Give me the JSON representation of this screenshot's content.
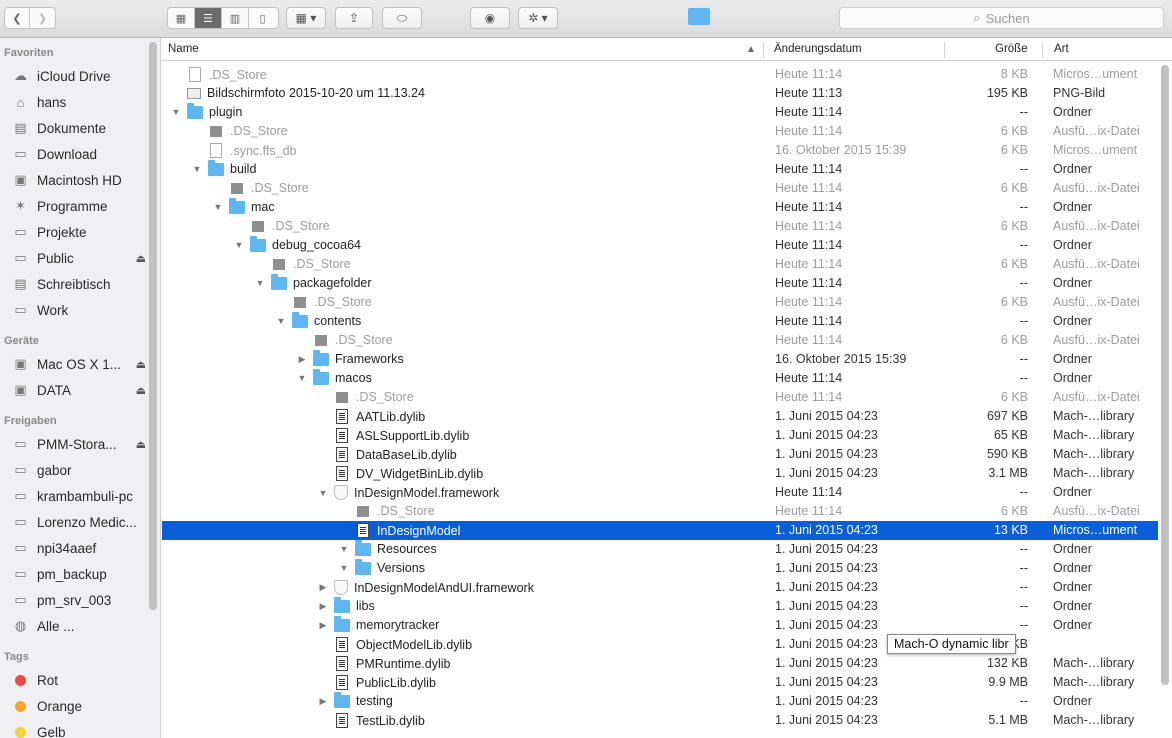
{
  "toolbar": {
    "back_icon": "chevron-left-icon",
    "forward_icon": "chevron-right-icon",
    "search_placeholder": "Suchen"
  },
  "sidebar": {
    "favorites_title": "Favoriten",
    "favorites": [
      {
        "label": "iCloud Drive",
        "icon": "cloud-icon",
        "glyph": "☁"
      },
      {
        "label": "hans",
        "icon": "home-icon",
        "glyph": "⌂"
      },
      {
        "label": "Dokumente",
        "icon": "document-icon",
        "glyph": "▤"
      },
      {
        "label": "Download",
        "icon": "folder-icon",
        "glyph": "▭"
      },
      {
        "label": "Macintosh HD",
        "icon": "hard-drive-icon",
        "glyph": "▣"
      },
      {
        "label": "Programme",
        "icon": "applications-icon",
        "glyph": "✶"
      },
      {
        "label": "Projekte",
        "icon": "folder-icon",
        "glyph": "▭"
      },
      {
        "label": "Public",
        "icon": "folder-icon",
        "glyph": "▭",
        "eject": true
      },
      {
        "label": "Schreibtisch",
        "icon": "desktop-icon",
        "glyph": "▤"
      },
      {
        "label": "Work",
        "icon": "folder-icon",
        "glyph": "▭"
      }
    ],
    "devices_title": "Geräte",
    "devices": [
      {
        "label": "Mac OS X 1...",
        "icon": "hard-drive-icon",
        "glyph": "▣",
        "eject": true
      },
      {
        "label": "DATA",
        "icon": "hard-drive-icon",
        "glyph": "▣",
        "eject": true
      }
    ],
    "shared_title": "Freigaben",
    "shared": [
      {
        "label": "PMM-Stora...",
        "icon": "server-icon",
        "glyph": "▭",
        "eject": true
      },
      {
        "label": "gabor",
        "icon": "computer-icon",
        "glyph": "▭"
      },
      {
        "label": "krambambuli-pc",
        "icon": "computer-icon",
        "glyph": "▭"
      },
      {
        "label": "Lorenzo Medic...",
        "icon": "computer-icon",
        "glyph": "▭"
      },
      {
        "label": "npi34aaef",
        "icon": "computer-icon",
        "glyph": "▭"
      },
      {
        "label": "pm_backup",
        "icon": "computer-icon",
        "glyph": "▭"
      },
      {
        "label": "pm_srv_003",
        "icon": "computer-icon",
        "glyph": "▭"
      },
      {
        "label": "Alle ...",
        "icon": "network-icon",
        "glyph": "◍"
      }
    ],
    "tags_title": "Tags",
    "tags": [
      {
        "label": "Rot",
        "color": "#f04848"
      },
      {
        "label": "Orange",
        "color": "#f5a631"
      },
      {
        "label": "Gelb",
        "color": "#f2d43b"
      }
    ]
  },
  "columns": {
    "name": "Name",
    "date": "Änderungsdatum",
    "size": "Größe",
    "kind": "Art"
  },
  "rows": [
    {
      "name": ".DS_Store",
      "date": "Heute 11:14",
      "size": "8 KB",
      "kind": "Micros…ument",
      "depth": 0,
      "icon": "docl",
      "dim": true
    },
    {
      "name": "Bildschirmfoto 2015-10-20 um 11.13.24",
      "date": "Heute 11:13",
      "size": "195 KB",
      "kind": "PNG-Bild",
      "depth": 0,
      "icon": "img"
    },
    {
      "name": "plugin",
      "date": "Heute 11:14",
      "size": "--",
      "kind": "Ordner",
      "depth": 0,
      "icon": "folder",
      "tri": "down"
    },
    {
      "name": ".DS_Store",
      "date": "Heute 11:14",
      "size": "6 KB",
      "kind": "Ausfü…ix-Datei",
      "depth": 1,
      "icon": "gray",
      "dim": true
    },
    {
      "name": ".sync.ffs_db",
      "date": "16. Oktober 2015 15:39",
      "size": "6 KB",
      "kind": "Micros…ument",
      "depth": 1,
      "icon": "docl",
      "dim": true
    },
    {
      "name": "build",
      "date": "Heute 11:14",
      "size": "--",
      "kind": "Ordner",
      "depth": 1,
      "icon": "folder",
      "tri": "down"
    },
    {
      "name": ".DS_Store",
      "date": "Heute 11:14",
      "size": "6 KB",
      "kind": "Ausfü…ix-Datei",
      "depth": 2,
      "icon": "gray",
      "dim": true
    },
    {
      "name": "mac",
      "date": "Heute 11:14",
      "size": "--",
      "kind": "Ordner",
      "depth": 2,
      "icon": "folder",
      "tri": "down"
    },
    {
      "name": ".DS_Store",
      "date": "Heute 11:14",
      "size": "6 KB",
      "kind": "Ausfü…ix-Datei",
      "depth": 3,
      "icon": "gray",
      "dim": true
    },
    {
      "name": "debug_cocoa64",
      "date": "Heute 11:14",
      "size": "--",
      "kind": "Ordner",
      "depth": 3,
      "icon": "folder",
      "tri": "down"
    },
    {
      "name": ".DS_Store",
      "date": "Heute 11:14",
      "size": "6 KB",
      "kind": "Ausfü…ix-Datei",
      "depth": 4,
      "icon": "gray",
      "dim": true
    },
    {
      "name": "packagefolder",
      "date": "Heute 11:14",
      "size": "--",
      "kind": "Ordner",
      "depth": 4,
      "icon": "folder",
      "tri": "down"
    },
    {
      "name": ".DS_Store",
      "date": "Heute 11:14",
      "size": "6 KB",
      "kind": "Ausfü…ix-Datei",
      "depth": 5,
      "icon": "gray",
      "dim": true
    },
    {
      "name": "contents",
      "date": "Heute 11:14",
      "size": "--",
      "kind": "Ordner",
      "depth": 5,
      "icon": "folder",
      "tri": "down"
    },
    {
      "name": ".DS_Store",
      "date": "Heute 11:14",
      "size": "6 KB",
      "kind": "Ausfü…ix-Datei",
      "depth": 6,
      "icon": "gray",
      "dim": true
    },
    {
      "name": "Frameworks",
      "date": "16. Oktober 2015 15:39",
      "size": "--",
      "kind": "Ordner",
      "depth": 6,
      "icon": "folder",
      "tri": "right"
    },
    {
      "name": "macos",
      "date": "Heute 11:14",
      "size": "--",
      "kind": "Ordner",
      "depth": 6,
      "icon": "folder",
      "tri": "down"
    },
    {
      "name": ".DS_Store",
      "date": "Heute 11:14",
      "size": "6 KB",
      "kind": "Ausfü…ix-Datei",
      "depth": 7,
      "icon": "gray",
      "dim": true
    },
    {
      "name": "AATLib.dylib",
      "date": "1. Juni 2015 04:23",
      "size": "697 KB",
      "kind": "Mach-…library",
      "depth": 7,
      "icon": "doc"
    },
    {
      "name": "ASLSupportLib.dylib",
      "date": "1. Juni 2015 04:23",
      "size": "65 KB",
      "kind": "Mach-…library",
      "depth": 7,
      "icon": "doc"
    },
    {
      "name": "DataBaseLib.dylib",
      "date": "1. Juni 2015 04:23",
      "size": "590 KB",
      "kind": "Mach-…library",
      "depth": 7,
      "icon": "doc"
    },
    {
      "name": "DV_WidgetBinLib.dylib",
      "date": "1. Juni 2015 04:23",
      "size": "3.1 MB",
      "kind": "Mach-…library",
      "depth": 7,
      "icon": "doc"
    },
    {
      "name": "InDesignModel.framework",
      "date": "Heute 11:14",
      "size": "--",
      "kind": "Ordner",
      "depth": 7,
      "icon": "fw",
      "tri": "down"
    },
    {
      "name": ".DS_Store",
      "date": "Heute 11:14",
      "size": "6 KB",
      "kind": "Ausfü…ix-Datei",
      "depth": 8,
      "icon": "gray",
      "dim": true
    },
    {
      "name": "InDesignModel",
      "date": "1. Juni 2015 04:23",
      "size": "13 KB",
      "kind": "Micros…ument",
      "depth": 8,
      "icon": "doc",
      "selected": true
    },
    {
      "name": "Resources",
      "date": "1. Juni 2015 04:23",
      "size": "--",
      "kind": "Ordner",
      "depth": 8,
      "icon": "folder",
      "tri": "down"
    },
    {
      "name": "Versions",
      "date": "1. Juni 2015 04:23",
      "size": "--",
      "kind": "Ordner",
      "depth": 8,
      "icon": "folder",
      "tri": "down"
    },
    {
      "name": "InDesignModelAndUI.framework",
      "date": "1. Juni 2015 04:23",
      "size": "--",
      "kind": "Ordner",
      "depth": 7,
      "icon": "fw",
      "tri": "right"
    },
    {
      "name": "libs",
      "date": "1. Juni 2015 04:23",
      "size": "--",
      "kind": "Ordner",
      "depth": 7,
      "icon": "folder",
      "tri": "right"
    },
    {
      "name": "memorytracker",
      "date": "1. Juni 2015 04:23",
      "size": "--",
      "kind": "Ordner",
      "depth": 7,
      "icon": "folder",
      "tri": "right"
    },
    {
      "name": "ObjectModelLib.dylib",
      "date": "1. Juni 2015 04:23",
      "size": "686 KB",
      "kind": "",
      "depth": 7,
      "icon": "doc"
    },
    {
      "name": "PMRuntime.dylib",
      "date": "1. Juni 2015 04:23",
      "size": "132 KB",
      "kind": "Mach-…library",
      "depth": 7,
      "icon": "doc"
    },
    {
      "name": "PublicLib.dylib",
      "date": "1. Juni 2015 04:23",
      "size": "9.9 MB",
      "kind": "Mach-…library",
      "depth": 7,
      "icon": "doc"
    },
    {
      "name": "testing",
      "date": "1. Juni 2015 04:23",
      "size": "--",
      "kind": "Ordner",
      "depth": 7,
      "icon": "folder",
      "tri": "right"
    },
    {
      "name": "TestLib.dylib",
      "date": "1. Juni 2015 04:23",
      "size": "5.1 MB",
      "kind": "Mach-…library",
      "depth": 7,
      "icon": "doc"
    }
  ],
  "tooltip": "Mach-O dynamic libr",
  "colors": {
    "selection": "#0a5fd6",
    "folder": "#5fb6f0"
  }
}
